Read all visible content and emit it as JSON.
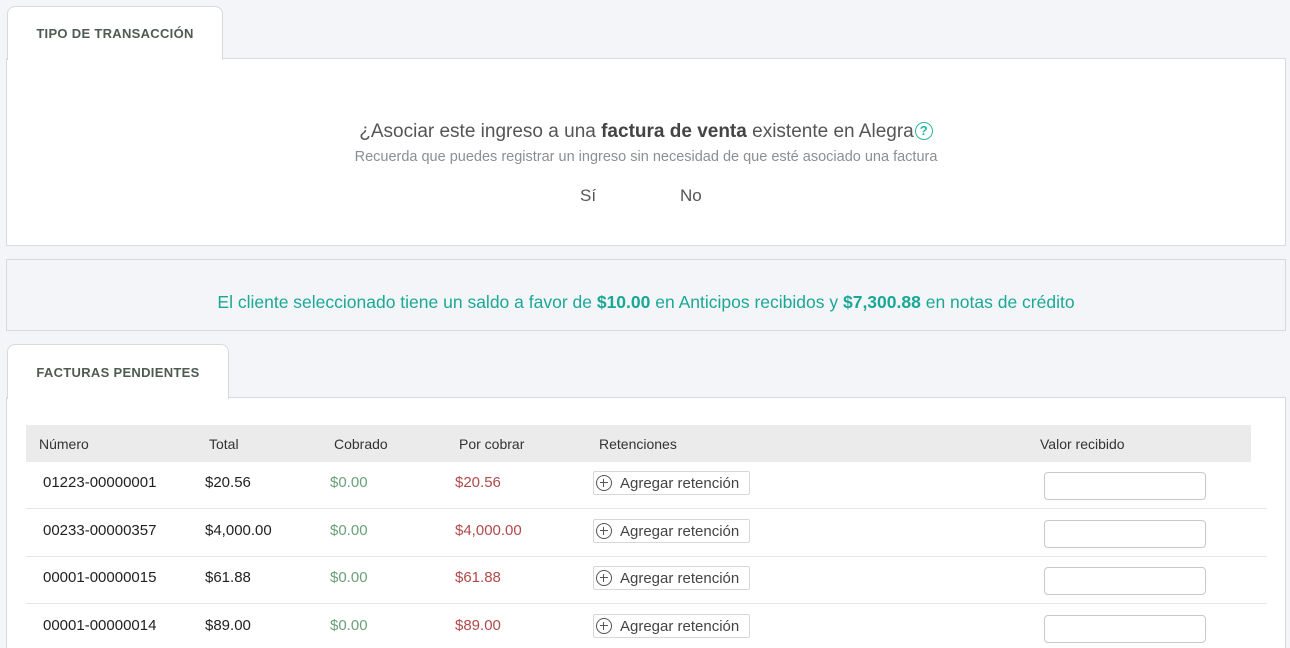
{
  "section1": {
    "tab_label": "TIPO DE TRANSACCIÓN",
    "question_prefix": "¿Asociar este ingreso a una ",
    "question_bold": "factura de venta",
    "question_suffix": " existente en Alegra",
    "help_icon": "question-circle-icon",
    "subtitle": "Recuerda que puedes registrar un ingreso sin necesidad de que esté asociado una factura",
    "option_yes": "Sí",
    "option_no": "No"
  },
  "balance": {
    "prefix": "El cliente seleccionado tiene un saldo a favor de ",
    "advance_amount": "$10.00",
    "middle": " en Anticipos recibidos y ",
    "credit_amount": "$7,300.88",
    "suffix": " en notas de crédito"
  },
  "invoices": {
    "tab_label": "FACTURAS PENDIENTES",
    "columns": {
      "numero": "Número",
      "total": "Total",
      "cobrado": "Cobrado",
      "por_cobrar": "Por cobrar",
      "retenciones": "Retenciones",
      "valor_recibido": "Valor recibido"
    },
    "add_retention_label": "Agregar retención",
    "rows": [
      {
        "numero": "01223-00000001",
        "total": "$20.56",
        "cobrado": "$0.00",
        "por_cobrar": "$20.56",
        "valor": ""
      },
      {
        "numero": "00233-00000357",
        "total": "$4,000.00",
        "cobrado": "$0.00",
        "por_cobrar": "$4,000.00",
        "valor": ""
      },
      {
        "numero": "00001-00000015",
        "total": "$61.88",
        "cobrado": "$0.00",
        "por_cobrar": "$61.88",
        "valor": ""
      },
      {
        "numero": "00001-00000014",
        "total": "$89.00",
        "cobrado": "$0.00",
        "por_cobrar": "$89.00",
        "valor": ""
      }
    ]
  },
  "colors": {
    "accent": "#2bb5a0",
    "paid_green": "#6aa07a",
    "due_red": "#b04a4a"
  }
}
